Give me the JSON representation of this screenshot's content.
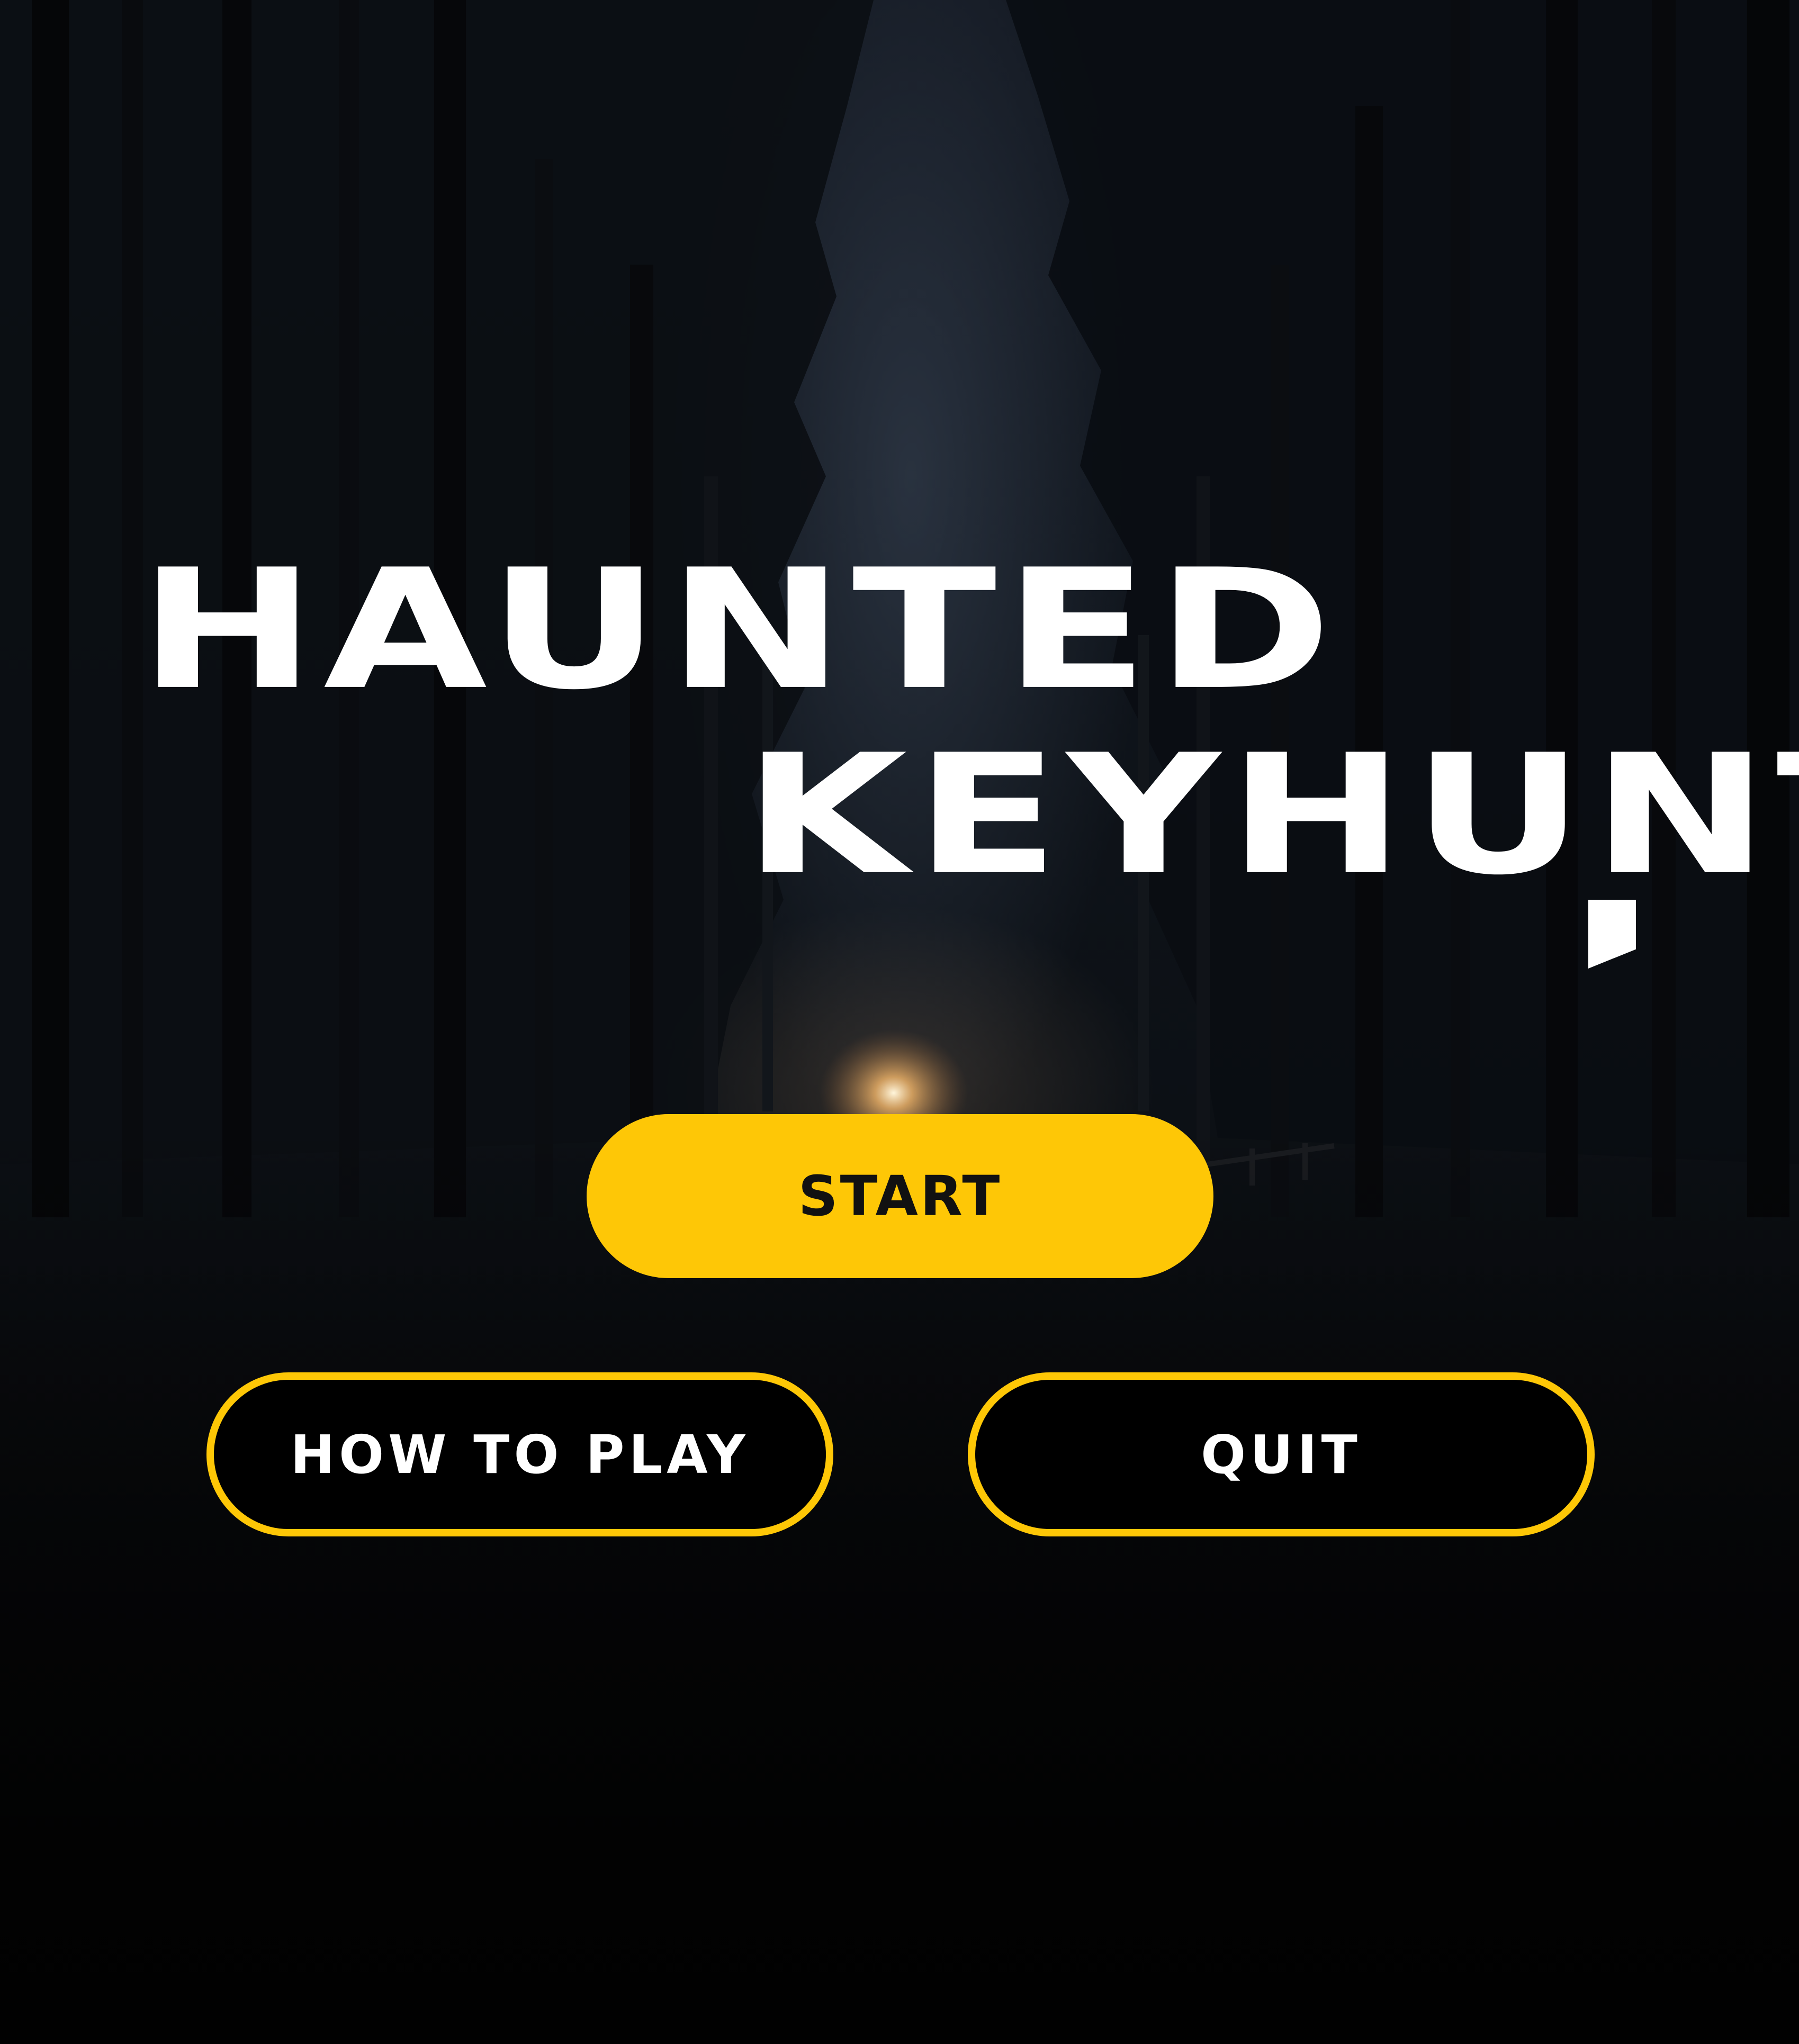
{
  "title": {
    "line1": "HAUNTED",
    "line2": "KEYHUNT"
  },
  "menu": {
    "start_label": "START",
    "how_to_play_label": "HOW TO PLAY",
    "quit_label": "QUIT"
  },
  "colors": {
    "accent": "#fec706",
    "title_text": "#ffffff",
    "background": "#07080a"
  }
}
